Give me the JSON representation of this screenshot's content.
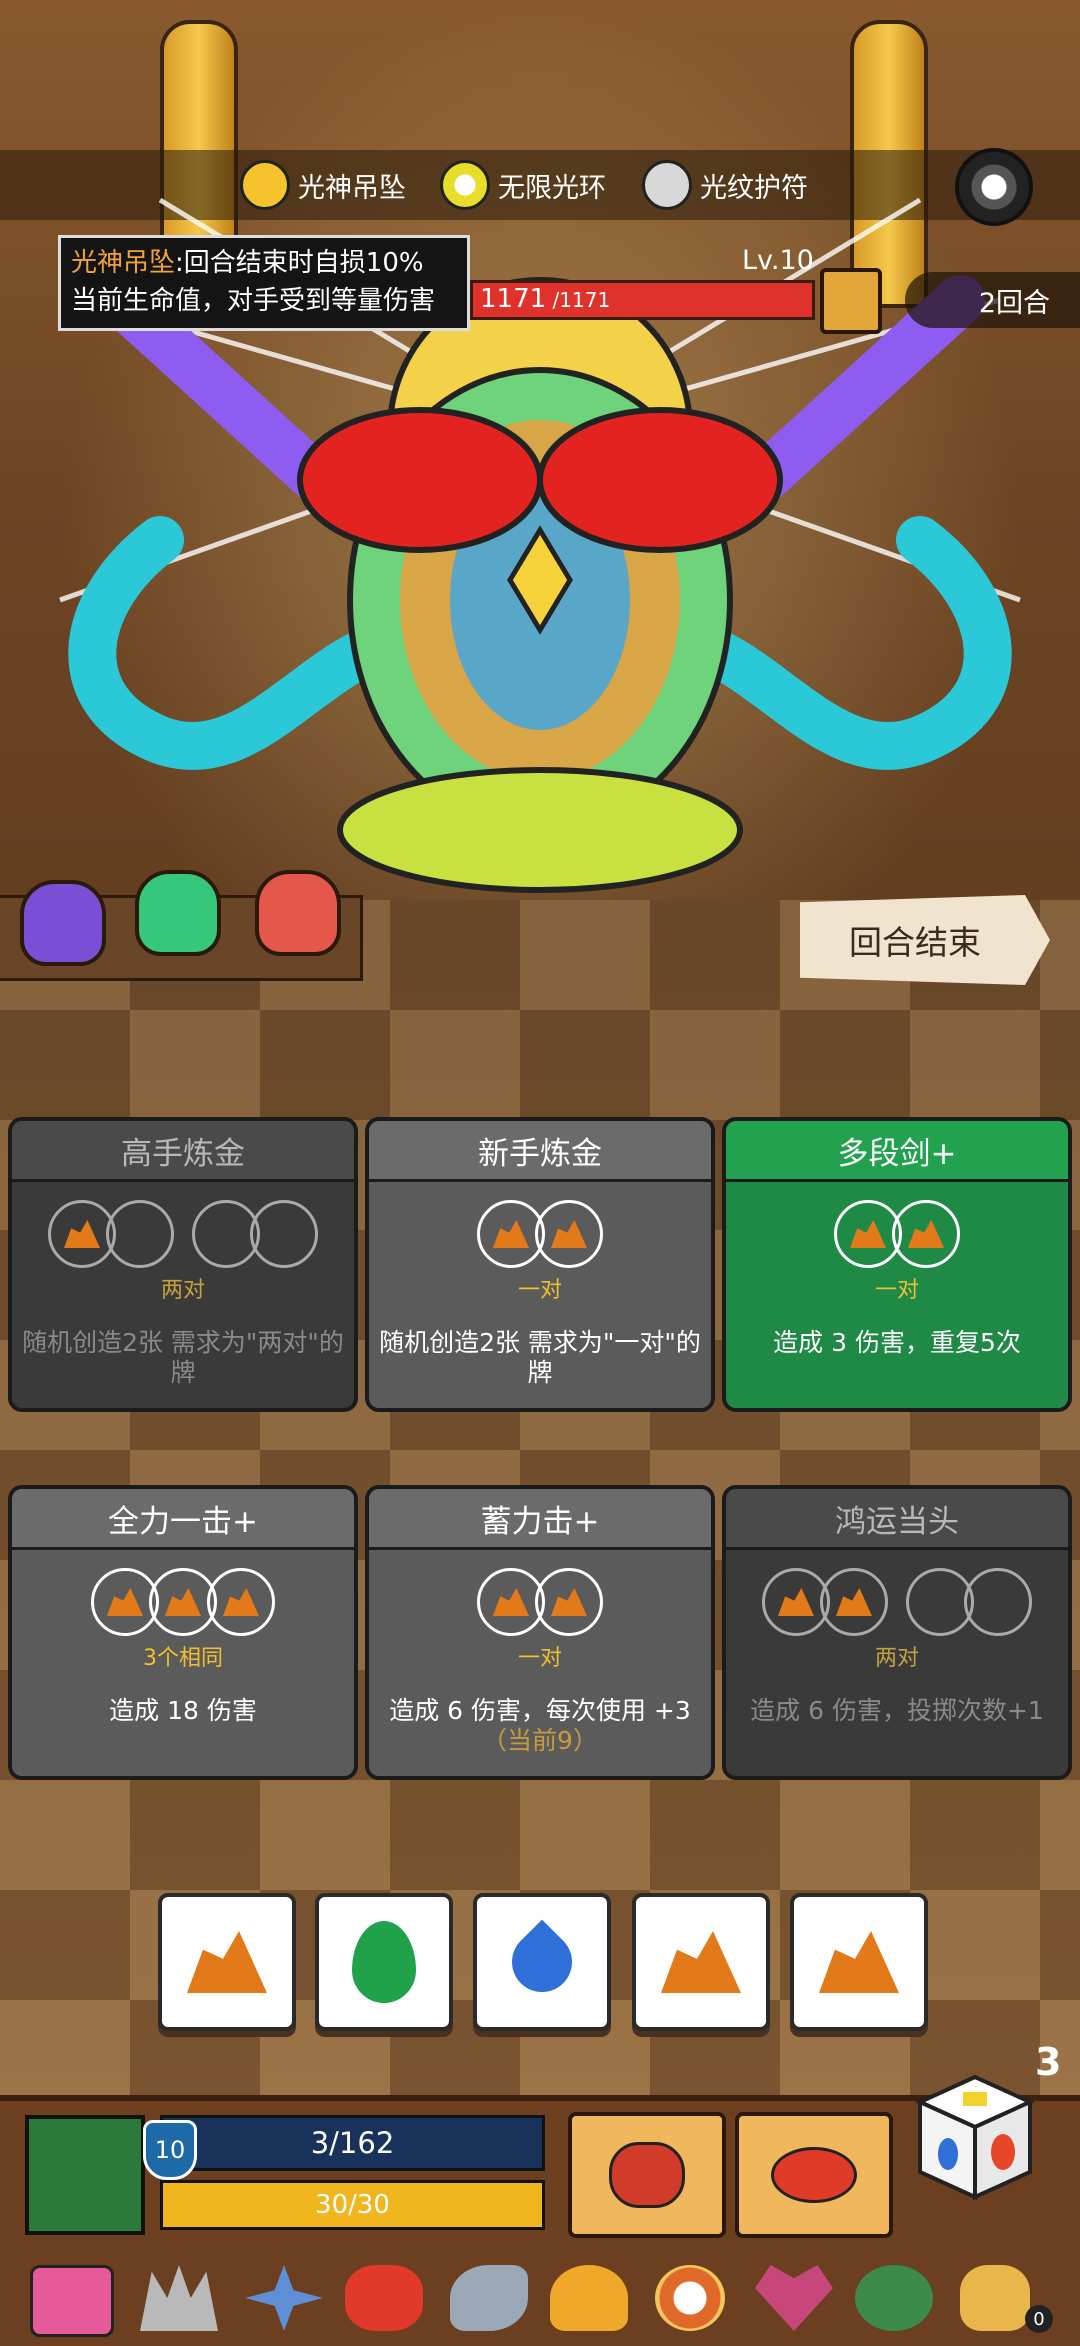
{
  "buffs": [
    {
      "label": "光神吊坠",
      "icon": "pendant-icon",
      "color": "#f6c32e"
    },
    {
      "label": "无限光环",
      "icon": "halo-icon",
      "color": "#e8dd2a"
    },
    {
      "label": "光纹护符",
      "icon": "amulet-icon",
      "color": "#d8d8d8"
    }
  ],
  "tooltip": {
    "name": "光神吊坠",
    "line1": ":回合结束时自损10%",
    "line2": "当前生命值，对手受到等量伤害"
  },
  "enemy": {
    "level": "Lv.10",
    "hp_current": "1171",
    "hp_max": " /1171",
    "hp_fraction": 1.0
  },
  "rounds_label": "2回合",
  "end_turn_label": "回合结束",
  "cards": [
    {
      "title": "高手炼金",
      "requirement": "两对",
      "description": "随机创造2张 需求为\"两对\"的牌",
      "state": "disabled"
    },
    {
      "title": "新手炼金",
      "requirement": "一对",
      "description": "随机创造2张 需求为\"一对\"的牌",
      "state": "normal"
    },
    {
      "title": "多段剑+",
      "requirement": "一对",
      "description": "造成 3 伤害，重复5次",
      "state": "highlight"
    },
    {
      "title": "全力一击+",
      "requirement": "3个相同",
      "description": "造成 18 伤害",
      "state": "normal"
    },
    {
      "title": "蓄力击+",
      "requirement": "一对",
      "description": "造成 6 伤害，每次使用 +3",
      "extra": "（当前9）",
      "state": "normal"
    },
    {
      "title": "鸿运当头",
      "requirement": "两对",
      "description": "造成 6 伤害，投掷次数+1",
      "state": "disabled"
    }
  ],
  "dice": [
    "rock",
    "leaf",
    "water",
    "rock",
    "rock"
  ],
  "player": {
    "level": "10",
    "xp": "3/162",
    "hp": "30/30"
  },
  "dice_remaining": "3",
  "coin_count": "0",
  "colors": {
    "card_gray": "#5b5b5b",
    "card_dark": "#3a3a3a",
    "card_green": "#1e8a45",
    "hp_red": "#e0322d",
    "hp_yellow": "#f1b51d"
  }
}
